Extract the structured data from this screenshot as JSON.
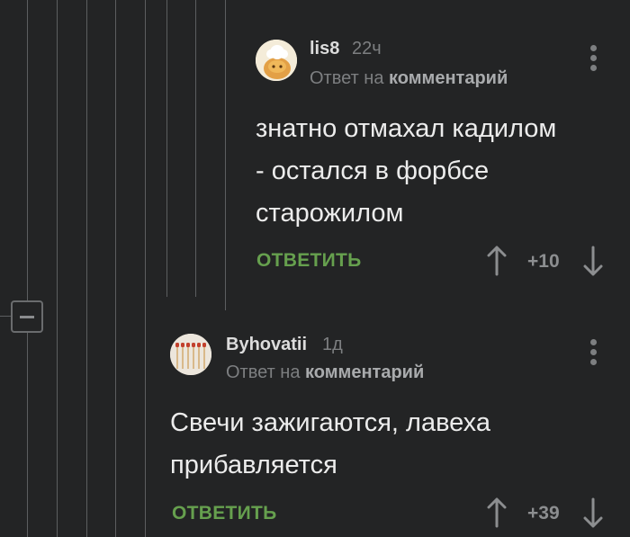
{
  "comments": [
    {
      "author": "lis8",
      "time": "22ч",
      "reply_prefix": "Ответ на ",
      "reply_target": "комментарий",
      "body_lines": [
        "знатно отмахал кадилом",
        "- остался в форбсе",
        "старожилом"
      ],
      "reply_label": "ОТВЕТИТЬ",
      "rating": "+10"
    },
    {
      "author": "Byhovatii",
      "time": "1д",
      "reply_prefix": "Ответ на ",
      "reply_target": "комментарий",
      "body_lines": [
        "Свечи зажигаются, лавеха",
        "прибавляется"
      ],
      "reply_label": "ОТВЕТИТЬ",
      "rating": "+39"
    }
  ],
  "icons": {
    "upvote": "arrow-up-icon",
    "downvote": "arrow-down-icon",
    "menu": "kebab-menu-icon",
    "collapse": "minus-icon"
  },
  "colors": {
    "background": "#232425",
    "reply_button": "#66a04e",
    "muted": "#7d7f81"
  }
}
